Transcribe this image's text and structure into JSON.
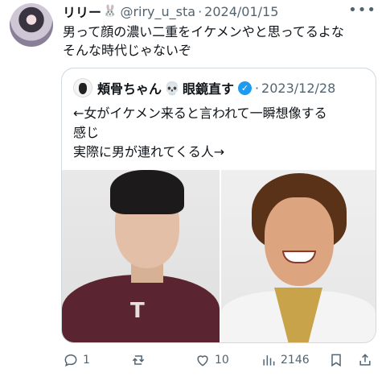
{
  "tweet": {
    "display_name": "リリー",
    "name_emoji": "🐰",
    "handle": "@riry_u_sta",
    "separator": "·",
    "date": "2024/01/15",
    "more_icon": "more-horizontal-icon",
    "text_lines": [
      "男って顔の濃い二重をイケメンやと思ってるよな",
      "そんな時代じゃないぞ"
    ]
  },
  "quote": {
    "display_name": "頬骨ちゃん",
    "name_emoji": "💀",
    "name_suffix": "眼鏡直す",
    "verified_icon": "verified-badge-icon",
    "separator": "·",
    "date": "2023/12/28",
    "text_lines": [
      "←女がイケメン来ると言われて一瞬想像する",
      "感じ",
      "実際に男が連れてくる人→"
    ],
    "images": [
      "photo-left-man-maroon-t-shirt",
      "photo-right-man-smiling"
    ]
  },
  "actions": {
    "reply_count": "1",
    "retweet_count": "",
    "like_count": "10",
    "views_count": "2146"
  }
}
